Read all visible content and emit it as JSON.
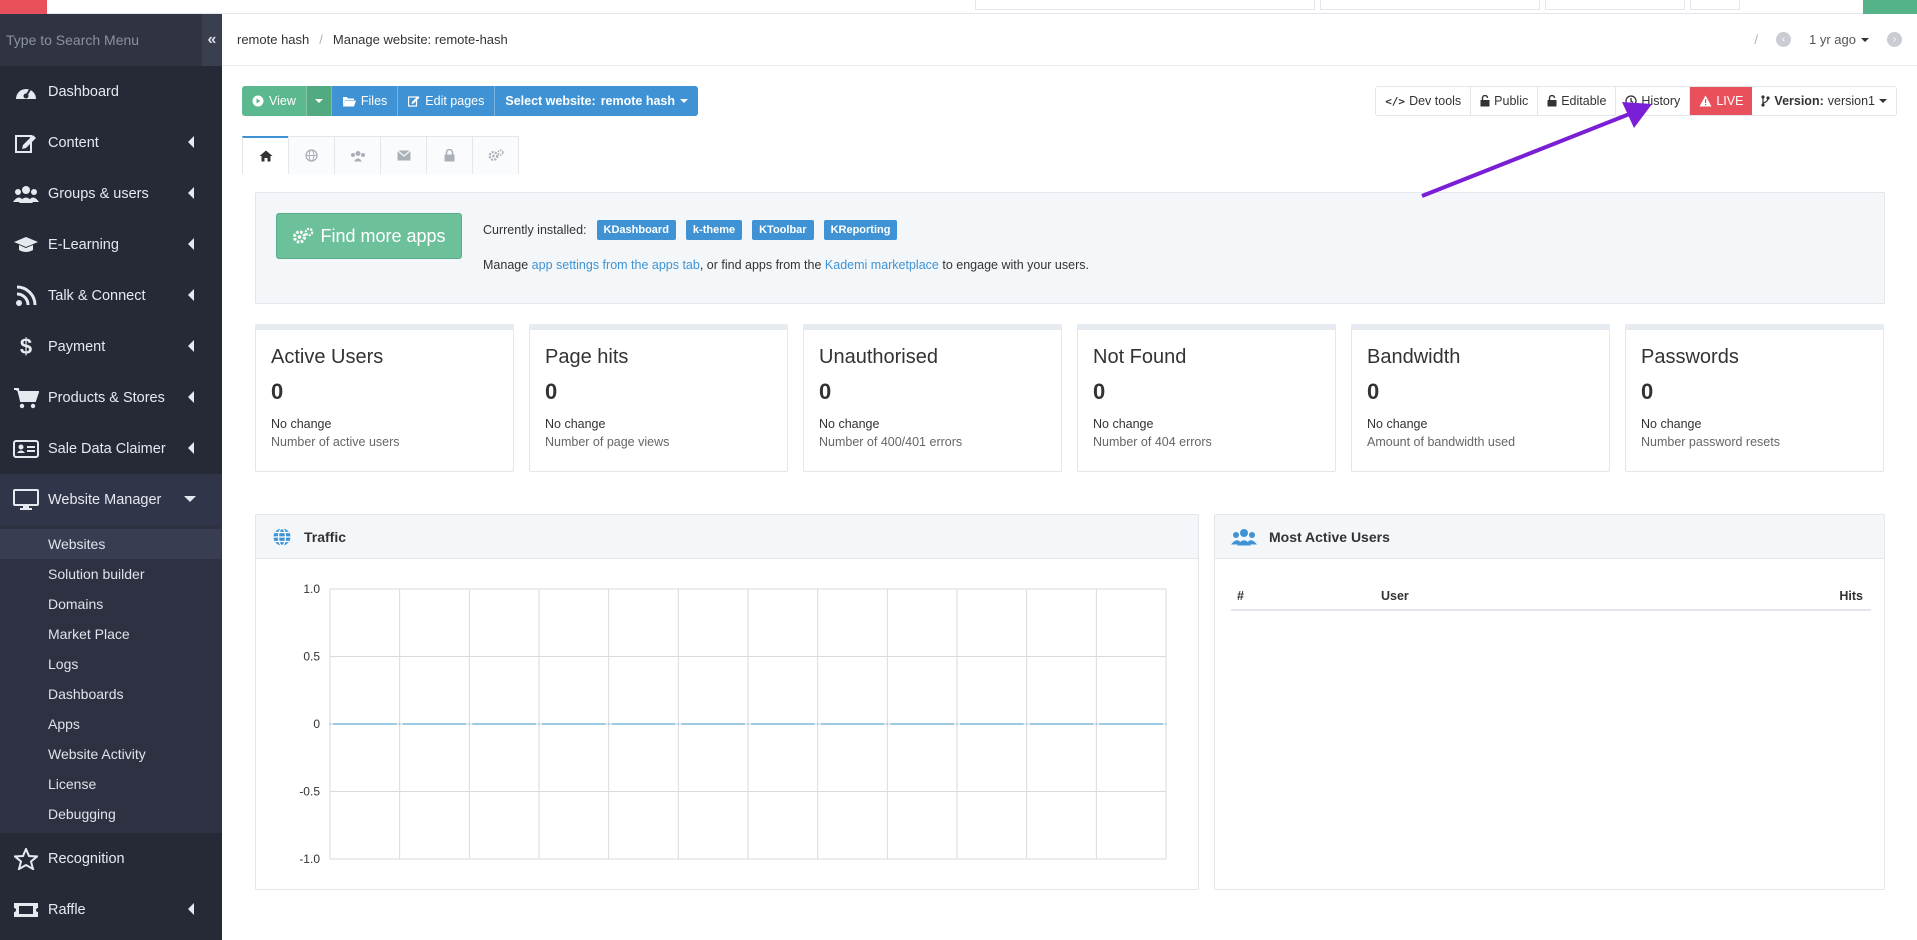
{
  "sidebar": {
    "search_placeholder": "Type to Search Menu",
    "collapse_glyph": "«",
    "items": [
      {
        "label": "Dashboard"
      },
      {
        "label": "Content"
      },
      {
        "label": "Groups & users"
      },
      {
        "label": "E-Learning"
      },
      {
        "label": "Talk & Connect"
      },
      {
        "label": "Payment"
      },
      {
        "label": "Products & Stores"
      },
      {
        "label": "Sale Data Claimer"
      },
      {
        "label": "Website Manager"
      },
      {
        "label": "Recognition"
      },
      {
        "label": "Raffle"
      }
    ],
    "subitems": [
      {
        "label": "Websites"
      },
      {
        "label": "Solution builder"
      },
      {
        "label": "Domains"
      },
      {
        "label": "Market Place"
      },
      {
        "label": "Logs"
      },
      {
        "label": "Dashboards"
      },
      {
        "label": "Apps"
      },
      {
        "label": "Website Activity"
      },
      {
        "label": "License"
      },
      {
        "label": "Debugging"
      }
    ]
  },
  "breadcrumb": {
    "root": "remote hash",
    "separator": "/",
    "current": "Manage website: remote-hash",
    "time": "1 yr ago"
  },
  "toolbar": {
    "view": "View",
    "files": "Files",
    "edit_pages": "Edit pages",
    "select_website_prefix": "Select website:",
    "select_website_value": "remote hash"
  },
  "rightbar": {
    "dev_tools": "Dev tools",
    "public": "Public",
    "editable": "Editable",
    "history": "History",
    "live": "LIVE",
    "version_label": "Version:",
    "version_value": "version1"
  },
  "apps": {
    "find_more": "Find more apps",
    "installed_label": "Currently installed:",
    "installed": [
      "KDashboard",
      "k-theme",
      "KToolbar",
      "KReporting"
    ],
    "manage_prefix": "Manage",
    "manage_link1": "app settings from the apps tab",
    "manage_mid": ", or find apps from the",
    "manage_link2": "Kademi marketplace",
    "manage_suffix": "to engage with your users."
  },
  "stats": [
    {
      "title": "Active Users",
      "value": "0",
      "change": "No change",
      "desc": "Number of active users"
    },
    {
      "title": "Page hits",
      "value": "0",
      "change": "No change",
      "desc": "Number of page views"
    },
    {
      "title": "Unauthorised",
      "value": "0",
      "change": "No change",
      "desc": "Number of 400/401 errors"
    },
    {
      "title": "Not Found",
      "value": "0",
      "change": "No change",
      "desc": "Number of 404 errors"
    },
    {
      "title": "Bandwidth",
      "value": "0",
      "change": "No change",
      "desc": "Amount of bandwidth used"
    },
    {
      "title": "Passwords",
      "value": "0",
      "change": "No change",
      "desc": "Number password resets"
    }
  ],
  "traffic": {
    "title": "Traffic"
  },
  "most_active": {
    "title": "Most Active Users",
    "columns": [
      "#",
      "User",
      "Hits"
    ]
  },
  "chart_data": {
    "type": "line",
    "x": [
      0,
      1,
      2,
      3,
      4,
      5,
      6,
      7,
      8,
      9,
      10,
      11,
      12
    ],
    "values": [
      0,
      0,
      0,
      0,
      0,
      0,
      0,
      0,
      0,
      0,
      0,
      0,
      0
    ],
    "ylim": [
      -1.0,
      1.0
    ],
    "yticks": [
      "1.0",
      "0.5",
      "0",
      "-0.5",
      "-1.0"
    ],
    "grid": true,
    "line_color": "#7ab8d9"
  },
  "colors": {
    "sidebar_bg": "#262a37",
    "accent_blue": "#3f93d4",
    "accent_green": "#5cb88e",
    "live_red": "#e8505b",
    "annotation_arrow": "#7a1fd6"
  }
}
